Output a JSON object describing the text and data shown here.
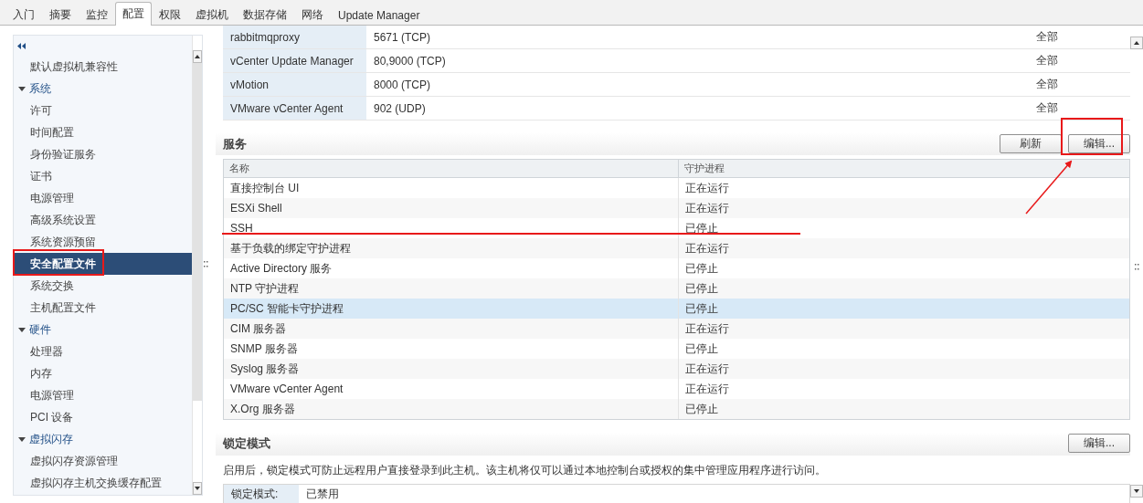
{
  "tabs": [
    {
      "label": "入门",
      "selected": false
    },
    {
      "label": "摘要",
      "selected": false
    },
    {
      "label": "监控",
      "selected": false
    },
    {
      "label": "配置",
      "selected": true
    },
    {
      "label": "权限",
      "selected": false
    },
    {
      "label": "虚拟机",
      "selected": false
    },
    {
      "label": "数据存储",
      "selected": false
    },
    {
      "label": "网络",
      "selected": false
    },
    {
      "label": "Update Manager",
      "selected": false
    }
  ],
  "sidebar": {
    "items": [
      {
        "label": "默认虚拟机兼容性",
        "selected": false
      },
      {
        "label": "系统",
        "expanded": true,
        "children": [
          {
            "label": "许可",
            "selected": false
          },
          {
            "label": "时间配置",
            "selected": false
          },
          {
            "label": "身份验证服务",
            "selected": false
          },
          {
            "label": "证书",
            "selected": false
          },
          {
            "label": "电源管理",
            "selected": false
          },
          {
            "label": "高级系统设置",
            "selected": false
          },
          {
            "label": "系统资源预留",
            "selected": false
          },
          {
            "label": "安全配置文件",
            "selected": true
          },
          {
            "label": "系统交换",
            "selected": false
          },
          {
            "label": "主机配置文件",
            "selected": false
          }
        ]
      },
      {
        "label": "硬件",
        "expanded": true,
        "children": [
          {
            "label": "处理器",
            "selected": false
          },
          {
            "label": "内存",
            "selected": false
          },
          {
            "label": "电源管理",
            "selected": false
          },
          {
            "label": "PCI 设备",
            "selected": false
          }
        ]
      },
      {
        "label": "虚拟闪存",
        "expanded": true,
        "children": [
          {
            "label": "虚拟闪存资源管理",
            "selected": false
          },
          {
            "label": "虚拟闪存主机交换缓存配置",
            "selected": false
          }
        ]
      }
    ]
  },
  "firewall": {
    "rows": [
      {
        "name": "rabbitmqproxy",
        "port": "5671 (TCP)",
        "scope": "全部"
      },
      {
        "name": "vCenter Update Manager",
        "port": "80,9000 (TCP)",
        "scope": "全部"
      },
      {
        "name": "vMotion",
        "port": "8000 (TCP)",
        "scope": "全部"
      },
      {
        "name": "VMware vCenter Agent",
        "port": "902 (UDP)",
        "scope": "全部"
      }
    ]
  },
  "services": {
    "title": "服务",
    "buttons": [
      "刷新",
      "编辑..."
    ],
    "columns": [
      "名称",
      "守护进程"
    ],
    "rows": [
      {
        "name": "直接控制台 UI",
        "status": "正在运行",
        "selected": false
      },
      {
        "name": "ESXi Shell",
        "status": "正在运行",
        "selected": false
      },
      {
        "name": "SSH",
        "status": "已停止",
        "selected": false
      },
      {
        "name": "基于负载的绑定守护进程",
        "status": "正在运行",
        "selected": false
      },
      {
        "name": "Active Directory 服务",
        "status": "已停止",
        "selected": false
      },
      {
        "name": "NTP 守护进程",
        "status": "已停止",
        "selected": false
      },
      {
        "name": "PC/SC 智能卡守护进程",
        "status": "已停止",
        "selected": true
      },
      {
        "name": "CIM 服务器",
        "status": "正在运行",
        "selected": false
      },
      {
        "name": "SNMP 服务器",
        "status": "已停止",
        "selected": false
      },
      {
        "name": "Syslog 服务器",
        "status": "正在运行",
        "selected": false
      },
      {
        "name": "VMware vCenter Agent",
        "status": "正在运行",
        "selected": false
      },
      {
        "name": "X.Org 服务器",
        "status": "已停止",
        "selected": false
      }
    ]
  },
  "lockdown": {
    "title": "锁定模式",
    "button": "编辑...",
    "description": "启用后，锁定模式可防止远程用户直接登录到此主机。该主机将仅可以通过本地控制台或授权的集中管理应用程序进行访问。",
    "rows": [
      {
        "label": "锁定模式:",
        "value": "已禁用"
      }
    ]
  }
}
